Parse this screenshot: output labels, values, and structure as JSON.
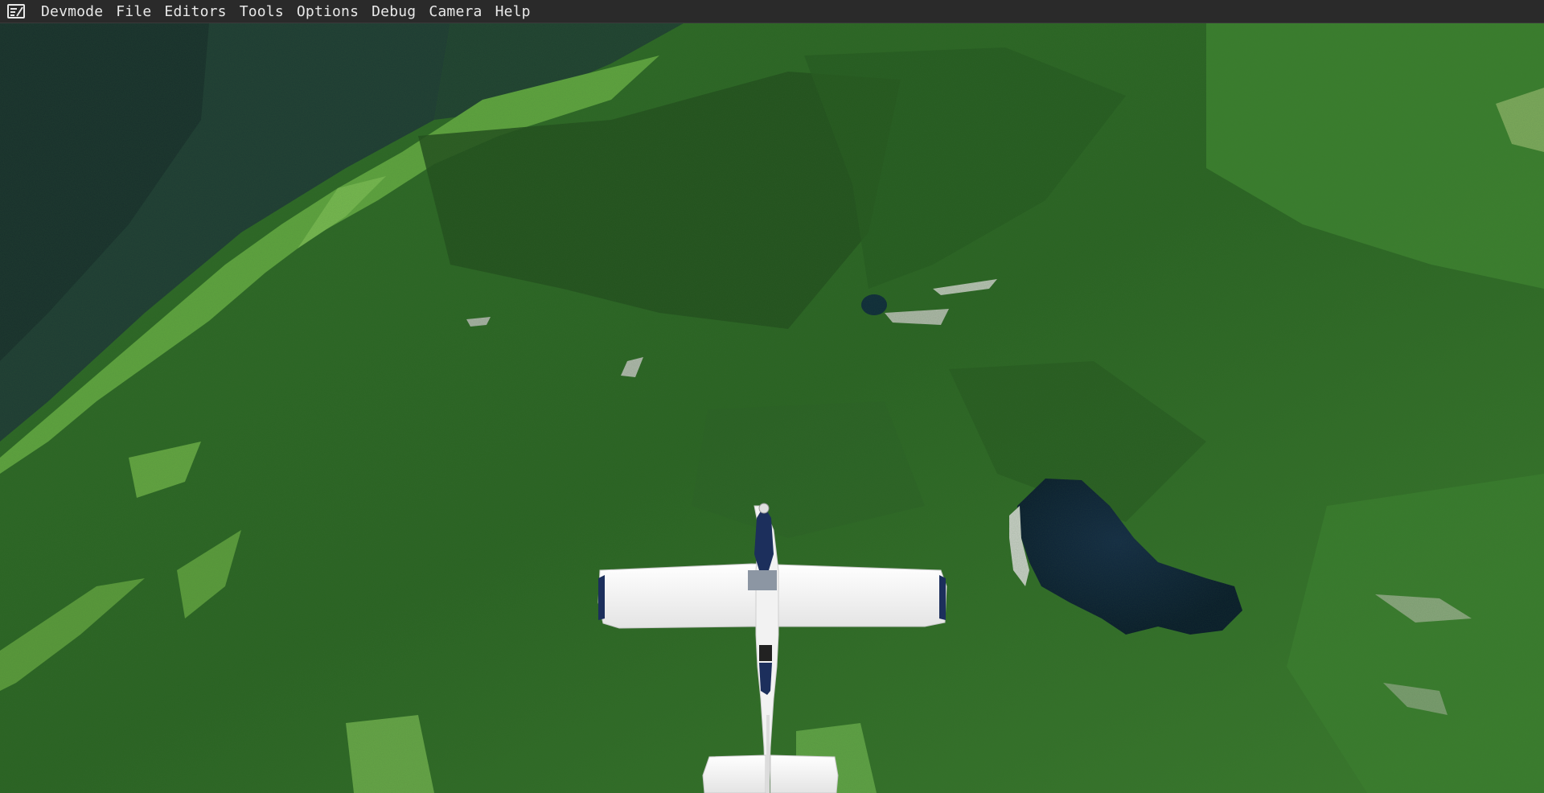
{
  "window": {
    "app_icon": "devmode-editor-icon"
  },
  "menubar": {
    "items": [
      {
        "label": "Devmode"
      },
      {
        "label": "File"
      },
      {
        "label": "Editors"
      },
      {
        "label": "Tools"
      },
      {
        "label": "Options"
      },
      {
        "label": "Debug"
      },
      {
        "label": "Camera"
      },
      {
        "label": "Help"
      }
    ]
  },
  "scene": {
    "description_icons": [
      "aircraft-top-view",
      "lake",
      "valley",
      "forest"
    ],
    "colors": {
      "forest_dark": "#1f4a1c",
      "forest_mid": "#2f6b24",
      "forest_light": "#4c8c34",
      "valley_field": "#6fae4a",
      "far_mountain": "#203a35",
      "lake": "#0c2035",
      "aircraft_white": "#f4f4f4",
      "aircraft_navy": "#1c2f5c"
    }
  }
}
